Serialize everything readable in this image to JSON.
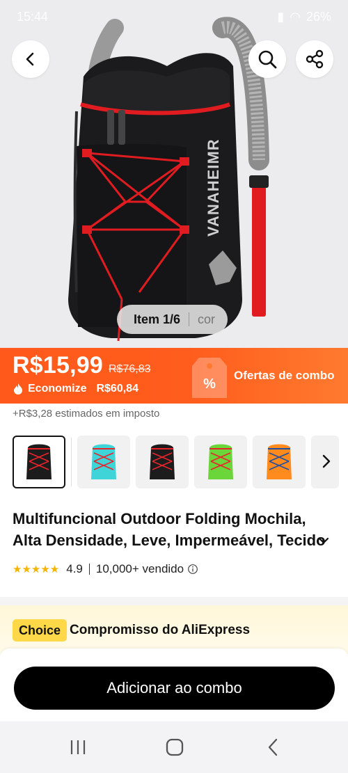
{
  "status_bar": {
    "time": "15:44",
    "battery": "26%"
  },
  "hero": {
    "brand_print": "VANAHEIMR",
    "item_counter": "Item 1/6",
    "item_counter_sub": "cor"
  },
  "price": {
    "current": "R$15,99",
    "original": "R$76,83",
    "save_label": "Economize",
    "save_amount": "R$60,84",
    "combo_label": "Ofertas de combo",
    "tax_note": "+R$3,28 estimados em imposto"
  },
  "variants": {
    "colors": [
      "#1c1c1c",
      "#3fd5d8",
      "#1c1c1c",
      "#6ad63a",
      "#ff8a1e"
    ],
    "accent": [
      "#e8242a",
      "#e8242a",
      "#e8242a",
      "#e8242a",
      "#1f4fa0"
    ],
    "selected_index": 0
  },
  "product": {
    "title_line1": "Multifuncional Outdoor Folding Mochila,",
    "title_line2": "Alta Densidade, Leve, Impermeável, Tecido",
    "rating_value": "4.9",
    "rating_stars": 5,
    "sold": "10,000+ vendido"
  },
  "choice": {
    "badge": "Choice",
    "text": "Compromisso do AliExpress"
  },
  "cta": {
    "label": "Adicionar ao combo"
  },
  "colors": {
    "price_bar": "#ff5a1b",
    "choice_badge": "#ffd84a",
    "star": "#f5b400",
    "cta_bg": "#000000"
  }
}
